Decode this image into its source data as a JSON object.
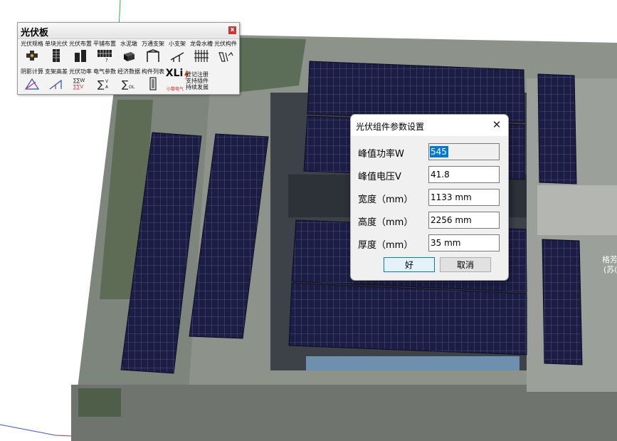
{
  "toolbar": {
    "title": "光伏板",
    "close": "x",
    "tools_row1": [
      {
        "label": "光伏规格",
        "icon": "pv-spec-icon"
      },
      {
        "label": "单块光伏",
        "icon": "single-panel-icon"
      },
      {
        "label": "光伏布置",
        "icon": "panel-layout-icon"
      },
      {
        "label": "平铺布置",
        "icon": "flat-layout-icon"
      },
      {
        "label": "水泥墩",
        "icon": "concrete-pier-icon"
      },
      {
        "label": "万通支架",
        "icon": "universal-bracket-icon"
      },
      {
        "label": "小支架",
        "icon": "small-bracket-icon"
      },
      {
        "label": "龙骨水槽",
        "icon": "keel-gutter-icon"
      },
      {
        "label": "光伏构件",
        "icon": "pv-component-icon"
      }
    ],
    "tools_row2": [
      {
        "label": "阴影计算",
        "icon": "shadow-calc-icon"
      },
      {
        "label": "支架高差",
        "icon": "bracket-height-icon"
      },
      {
        "label": "光伏功率",
        "icon": "pv-power-icon"
      },
      {
        "label": "电气参数",
        "icon": "electrical-params-icon"
      },
      {
        "label": "经济数据",
        "icon": "economic-data-icon"
      },
      {
        "label": "构件列表",
        "icon": "component-list-icon"
      },
      {
        "label": "XLi",
        "sublabel": "小黎电气",
        "icon": "xli-logo-icon"
      }
    ],
    "register_lines": [
      "登记注册",
      "支持插件",
      "持续发展"
    ]
  },
  "dialog": {
    "title": "光伏组件参数设置",
    "fields": [
      {
        "label": "峰值功率W",
        "value": "545",
        "selected": true
      },
      {
        "label": "峰值电压V",
        "value": "41.8"
      },
      {
        "label": "宽度（mm）",
        "value": "1133 mm"
      },
      {
        "label": "高度（mm）",
        "value": "2256 mm"
      },
      {
        "label": "厚度（mm）",
        "value": "35 mm"
      }
    ],
    "ok_label": "好",
    "cancel_label": "取消"
  },
  "map": {
    "place_label": [
      "格芳",
      "(苏("
    ]
  },
  "colors": {
    "panel": "#1c1d45",
    "panel_grid": "#5b5f8a",
    "dialog_bg": "#f0f0f0",
    "selection": "#0078d7"
  }
}
